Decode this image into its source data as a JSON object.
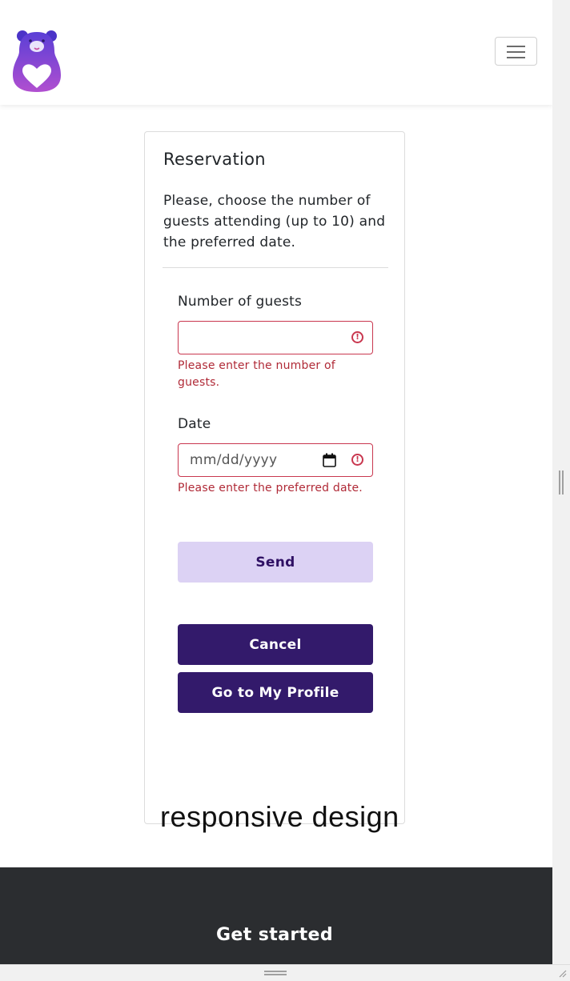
{
  "navbar": {
    "logo_icon": "bear-heart-logo-icon",
    "toggle_icon": "hamburger-menu-icon"
  },
  "reservation": {
    "title": "Reservation",
    "description": "Please, choose the number of guests attending (up to 10) and the preferred date.",
    "guests_label": "Number of guests",
    "guests_value": "",
    "guests_error": "Please enter the number of guests.",
    "date_label": "Date",
    "date_placeholder": "mm/dd/yyyy",
    "date_error": "Please enter the preferred date.",
    "send_label": "Send",
    "cancel_label": "Cancel",
    "profile_label": "Go to My Profile"
  },
  "watermark": "responsive design",
  "footer": {
    "heading": "Get started"
  },
  "colors": {
    "accent_dark": "#331a6b",
    "accent_light": "#dcd2f4",
    "error": "#c9374f",
    "footer_bg": "#2b2d30"
  }
}
